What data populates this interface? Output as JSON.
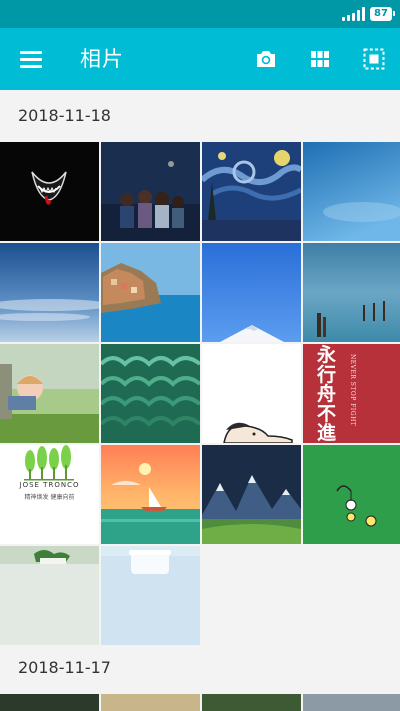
{
  "status_bar": {
    "battery": "87",
    "icons": [
      "signal-icon",
      "battery-icon"
    ]
  },
  "app_bar": {
    "title": "相片",
    "icons": [
      "menu-icon",
      "camera-icon",
      "grid-view-icon",
      "select-icon"
    ]
  },
  "sections": [
    {
      "date": "2018-11-18",
      "photos": [
        {
          "subject": "venom-logo"
        },
        {
          "subject": "group-illustration"
        },
        {
          "subject": "starry-night-painting"
        },
        {
          "subject": "blue-sky"
        },
        {
          "subject": "blue-sky-clouds"
        },
        {
          "subject": "coastal-village"
        },
        {
          "subject": "snow-mountain-peak"
        },
        {
          "subject": "sea-with-posts"
        },
        {
          "subject": "child-at-window"
        },
        {
          "subject": "peacock-feathers"
        },
        {
          "subject": "cartoon-face"
        },
        {
          "subject": "red-calligraphy-poster"
        },
        {
          "subject": "green-trees-logo"
        },
        {
          "subject": "sailboat-sunset"
        },
        {
          "subject": "mountain-landscape"
        },
        {
          "subject": "green-bird"
        },
        {
          "subject": "plant-bowl"
        },
        {
          "subject": "white-pot"
        }
      ],
      "overlay_text": {
        "tree_logo_line1": "JOSE TRONCO",
        "tree_logo_line2": "精神焕发 健康向前",
        "calligraphy_main": "永行舟不進則",
        "calligraphy_side": "NEVER STOP FIGHT"
      }
    },
    {
      "date": "2018-11-17",
      "photos": [
        {
          "subject": "dark-green"
        },
        {
          "subject": "sand"
        },
        {
          "subject": "forest"
        },
        {
          "subject": "grey-sky"
        }
      ]
    }
  ],
  "colors": {
    "status_bar": "#0097a7",
    "app_bar": "#00bcd4",
    "background": "#f3f3f3",
    "text": "#333333"
  }
}
